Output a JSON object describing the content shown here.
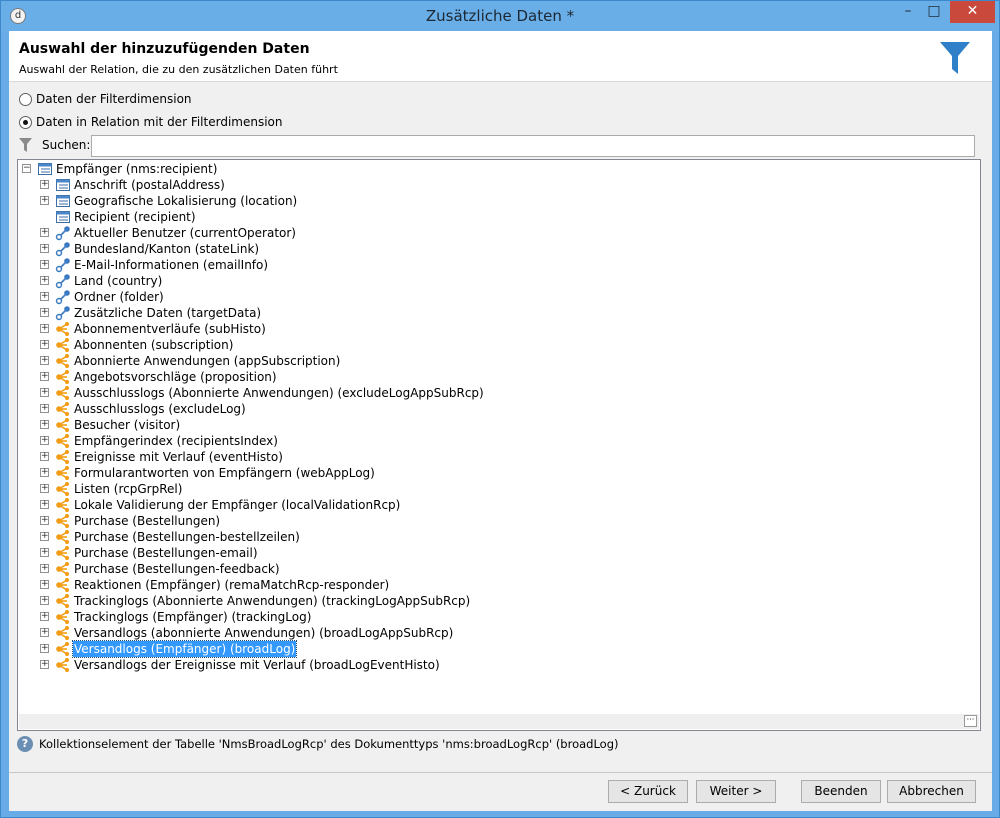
{
  "window": {
    "title": "Zusätzliche Daten *",
    "minimize_glyph": "–",
    "maximize_glyph": "□",
    "close_glyph": "✕",
    "app_icon_glyph": "d"
  },
  "header": {
    "title": "Auswahl der hinzuzufügenden Daten",
    "subtitle": "Auswahl der Relation, die zu den zusätzlichen Daten führt",
    "icon": "funnel-icon"
  },
  "options": {
    "radio_filter_dimension": "Daten der Filterdimension",
    "radio_related_data": "Daten in Relation mit der Filterdimension",
    "selected": "radio_related_data"
  },
  "search": {
    "label": "Suchen:",
    "value": "",
    "placeholder": ""
  },
  "tree": {
    "root": "Empfänger (nms:recipient)",
    "items": [
      {
        "label": "Anschrift (postalAddress)",
        "icon": "table-icon",
        "expandable": true
      },
      {
        "label": "Geografische Lokalisierung (location)",
        "icon": "table-icon",
        "expandable": true
      },
      {
        "label": "Recipient (recipient)",
        "icon": "table-icon",
        "expandable": false
      },
      {
        "label": "Aktueller Benutzer (currentOperator)",
        "icon": "link-icon",
        "expandable": true
      },
      {
        "label": "Bundesland/Kanton (stateLink)",
        "icon": "link-icon",
        "expandable": true
      },
      {
        "label": "E-Mail-Informationen (emailInfo)",
        "icon": "link-icon",
        "expandable": true
      },
      {
        "label": "Land (country)",
        "icon": "link-icon",
        "expandable": true
      },
      {
        "label": "Ordner (folder)",
        "icon": "link-icon",
        "expandable": true
      },
      {
        "label": "Zusätzliche Daten (targetData)",
        "icon": "link-icon",
        "expandable": true
      },
      {
        "label": "Abonnementverläufe (subHisto)",
        "icon": "collection-icon",
        "expandable": true
      },
      {
        "label": "Abonnenten (subscription)",
        "icon": "collection-icon",
        "expandable": true
      },
      {
        "label": "Abonnierte Anwendungen (appSubscription)",
        "icon": "collection-icon",
        "expandable": true
      },
      {
        "label": "Angebotsvorschläge (proposition)",
        "icon": "collection-icon",
        "expandable": true
      },
      {
        "label": "Ausschlusslogs (Abonnierte Anwendungen) (excludeLogAppSubRcp)",
        "icon": "collection-icon",
        "expandable": true
      },
      {
        "label": "Ausschlusslogs (excludeLog)",
        "icon": "collection-icon",
        "expandable": true
      },
      {
        "label": "Besucher (visitor)",
        "icon": "collection-icon",
        "expandable": true
      },
      {
        "label": "Empfängerindex (recipientsIndex)",
        "icon": "collection-icon",
        "expandable": true
      },
      {
        "label": "Ereignisse mit Verlauf (eventHisto)",
        "icon": "collection-icon",
        "expandable": true
      },
      {
        "label": "Formularantworten von Empfängern (webAppLog)",
        "icon": "collection-icon",
        "expandable": true
      },
      {
        "label": "Listen (rcpGrpRel)",
        "icon": "collection-icon",
        "expandable": true
      },
      {
        "label": "Lokale Validierung der Empfänger (localValidationRcp)",
        "icon": "collection-icon",
        "expandable": true
      },
      {
        "label": "Purchase (Bestellungen)",
        "icon": "collection-icon",
        "expandable": true
      },
      {
        "label": "Purchase (Bestellungen-bestellzeilen)",
        "icon": "collection-icon",
        "expandable": true
      },
      {
        "label": "Purchase (Bestellungen-email)",
        "icon": "collection-icon",
        "expandable": true
      },
      {
        "label": "Purchase (Bestellungen-feedback)",
        "icon": "collection-icon",
        "expandable": true
      },
      {
        "label": "Reaktionen (Empfänger) (remaMatchRcp-responder)",
        "icon": "collection-icon",
        "expandable": true
      },
      {
        "label": "Trackinglogs (Abonnierte Anwendungen) (trackingLogAppSubRcp)",
        "icon": "collection-icon",
        "expandable": true
      },
      {
        "label": "Trackinglogs (Empfänger) (trackingLog)",
        "icon": "collection-icon",
        "expandable": true
      },
      {
        "label": "Versandlogs (abonnierte Anwendungen) (broadLogAppSubRcp)",
        "icon": "collection-icon",
        "expandable": true
      },
      {
        "label": "Versandlogs (Empfänger) (broadLog)",
        "icon": "collection-icon",
        "expandable": true,
        "selected": true
      },
      {
        "label": "Versandlogs der Ereignisse mit Verlauf (broadLogEventHisto)",
        "icon": "collection-icon",
        "expandable": true
      }
    ]
  },
  "info": {
    "text": "Kollektionselement der Tabelle 'NmsBroadLogRcp' des Dokumenttyps 'nms:broadLogRcp' (broadLog)"
  },
  "buttons": {
    "back": "< Zurück",
    "next": "Weiter >",
    "finish": "Beenden",
    "cancel": "Abbrechen"
  },
  "colors": {
    "titlebar": "#6aaee8",
    "close_button": "#c9493c",
    "selection": "#3399ff",
    "link_icon": "#3a79c4",
    "collection_icon": "#f39c12",
    "funnel": "#2f80c8"
  }
}
